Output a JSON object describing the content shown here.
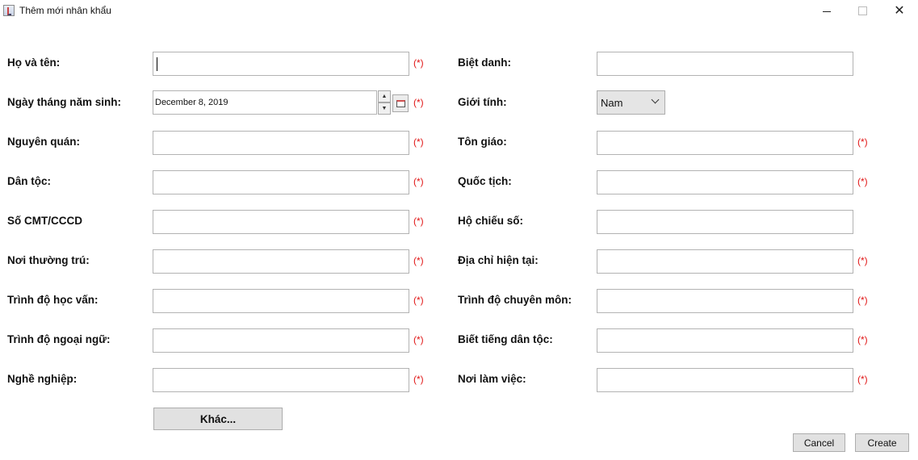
{
  "window": {
    "title": "Thêm mới nhân khẩu",
    "minimize_symbol": "",
    "close_symbol": "✕"
  },
  "required_marker": "(*)",
  "left_fields": [
    {
      "label": "Họ và tên:",
      "value": "",
      "required": true
    },
    {
      "label": "Ngày tháng năm sinh:",
      "value": "December 8, 2019",
      "required": true
    },
    {
      "label": "Nguyên quán:",
      "value": "",
      "required": true
    },
    {
      "label": "Dân tộc:",
      "value": "",
      "required": true
    },
    {
      "label": "Số CMT/CCCD",
      "value": "",
      "required": true
    },
    {
      "label": "Nơi thường trú:",
      "value": "",
      "required": true
    },
    {
      "label": "Trình độ học vấn:",
      "value": "",
      "required": true
    },
    {
      "label": "Trình độ ngoại ngữ:",
      "value": "",
      "required": true
    },
    {
      "label": "Nghề nghiệp:",
      "value": "",
      "required": true
    }
  ],
  "right_fields": [
    {
      "label": "Biệt danh:",
      "value": "",
      "required": false
    },
    {
      "label": "Giới tính:",
      "value": "Nam",
      "required": false
    },
    {
      "label": "Tôn giáo:",
      "value": "",
      "required": true
    },
    {
      "label": "Quốc tịch:",
      "value": "",
      "required": true
    },
    {
      "label": "Hộ chiếu số:",
      "value": "",
      "required": false
    },
    {
      "label": "Địa chỉ hiện tại:",
      "value": "",
      "required": true
    },
    {
      "label": "Trình độ chuyên môn:",
      "value": "",
      "required": true
    },
    {
      "label": "Biết tiếng dân tộc:",
      "value": "",
      "required": true
    },
    {
      "label": "Nơi làm việc:",
      "value": "",
      "required": true
    }
  ],
  "spinner": {
    "up": "▲",
    "down": "▼"
  },
  "buttons": {
    "other": "Khác...",
    "cancel": "Cancel",
    "create": "Create"
  },
  "icons": {
    "app": "java-app-icon",
    "calendar": "calendar-icon",
    "dropdown": "chevron-down-icon"
  }
}
